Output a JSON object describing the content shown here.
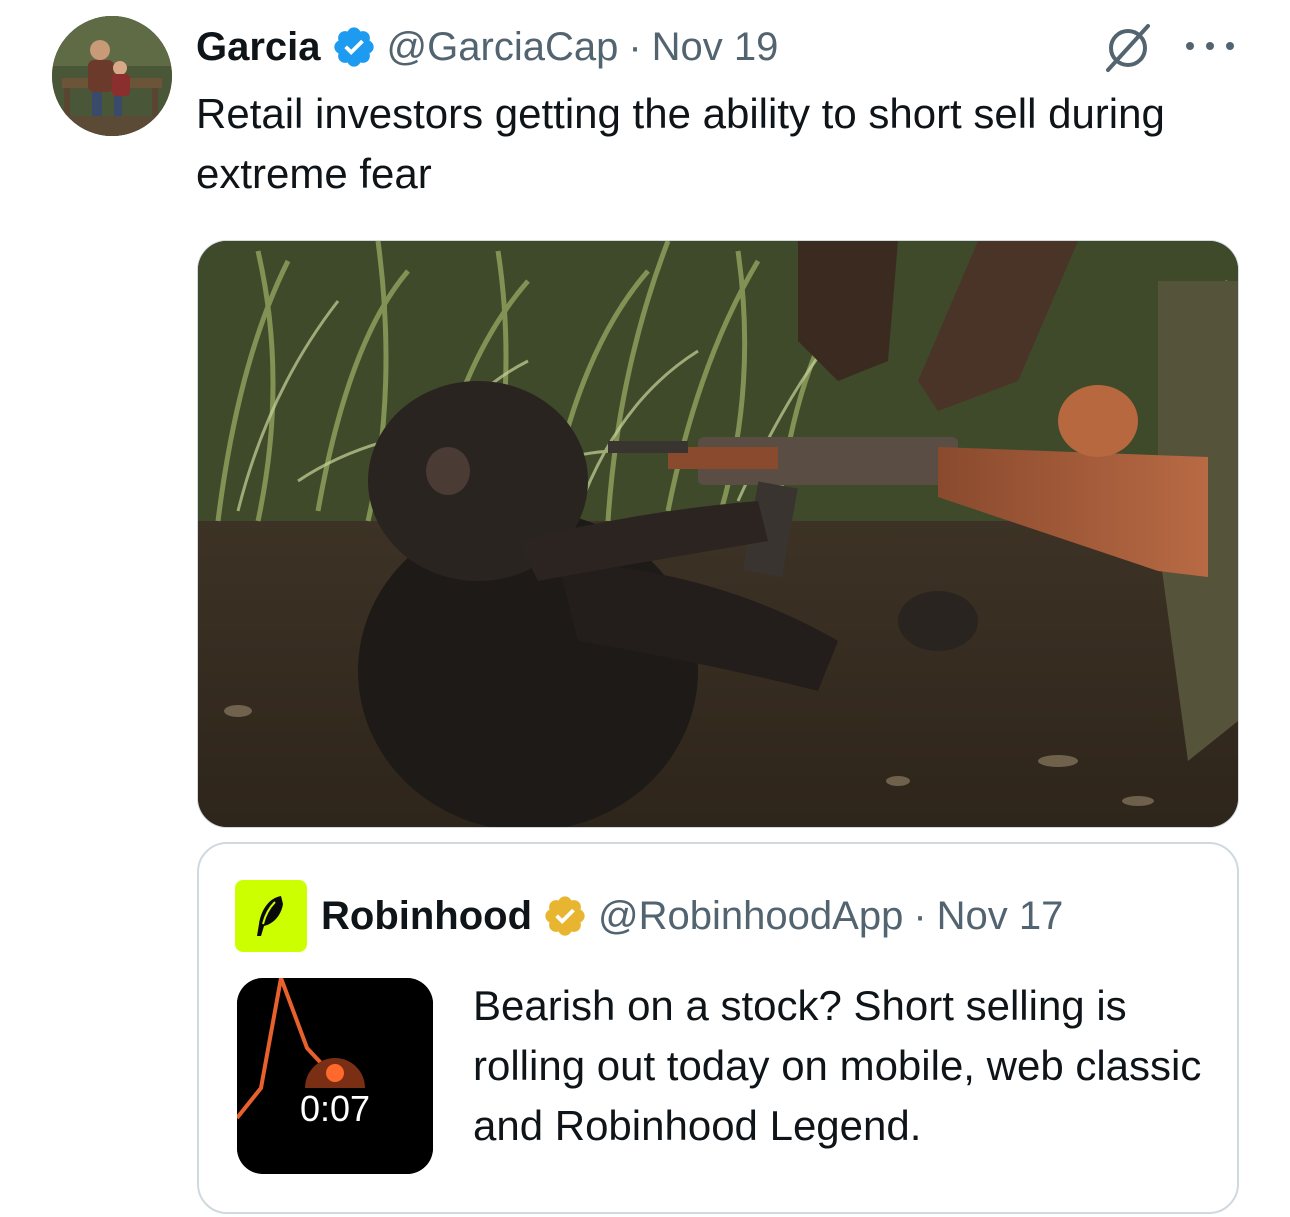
{
  "tweet": {
    "author_name": "Garcia",
    "handle": "@GarciaCap",
    "separator": "·",
    "date": "Nov 19",
    "text": "Retail investors getting the ability to short sell during extreme fear",
    "media_description_alt": "Chimpanzee grabbing an assault rifle",
    "verified_color": "#1d9bf0"
  },
  "quoted_tweet": {
    "author_name": "Robinhood",
    "handle": "@RobinhoodApp",
    "separator": "·",
    "date": "Nov 17",
    "text": "Bearish on a stock? Short selling is rolling out today on mobile, web classic and Robinhood Legend.",
    "video_duration": "0:07",
    "verified_color": "#e8b530",
    "avatar_color": "#ccff00"
  },
  "icons": {
    "grok": "grok-icon",
    "more": "more-icon",
    "verified": "verified-badge-icon",
    "gold_verified": "gold-verified-badge-icon"
  }
}
